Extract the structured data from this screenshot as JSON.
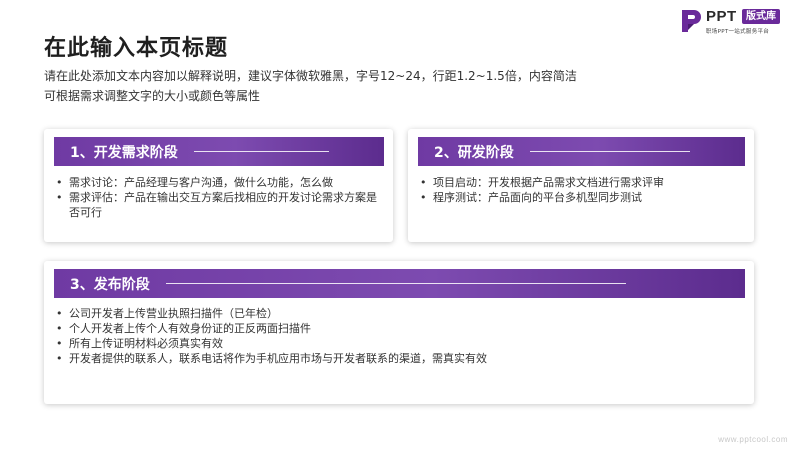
{
  "brand": {
    "name": "PPT",
    "badge": "版式库",
    "tagline": "职场PPT一站式服务平台",
    "accent_color": "#6a2a9a",
    "header_gradient": [
      "#6f3aa3",
      "#5c2c8e"
    ]
  },
  "page": {
    "title": "在此输入本页标题",
    "subtitle_lines": [
      "请在此处添加文本内容加以解释说明，建议字体微软雅黑，字号12~24，行距1.2~1.5倍，内容简洁",
      "可根据需求调整文字的大小或颜色等属性"
    ]
  },
  "sections": [
    {
      "title": "1、开发需求阶段",
      "items": [
        "需求讨论：产品经理与客户沟通，做什么功能，怎么做",
        "需求评估：产品在输出交互方案后找相应的开发讨论需求方案是否可行"
      ]
    },
    {
      "title": "2、研发阶段",
      "items": [
        "项目启动：开发根据产品需求文档进行需求评审",
        "程序测试：产品面向的平台多机型同步测试"
      ]
    },
    {
      "title": "3、发布阶段",
      "items": [
        "公司开发者上传营业执照扫描件（已年检）",
        "个人开发者上传个人有效身份证的正反两面扫描件",
        "所有上传证明材料必须真实有效",
        "开发者提供的联系人，联系电话将作为手机应用市场与开发者联系的渠道，需真实有效"
      ]
    }
  ],
  "watermark": "www.pptcool.com"
}
